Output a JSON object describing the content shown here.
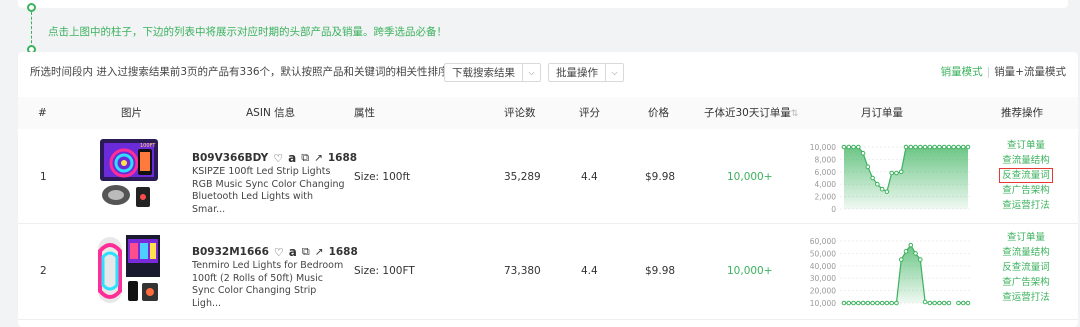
{
  "tip_text": "点击上图中的柱子，下边的列表中将展示对应时期的头部产品及销量。跨季选品必备！",
  "toolbar": {
    "info": "所选时间段内 进入过搜索结果前3页的产品有336个，默认按照产品和关键词的相关性排序",
    "download_label": "下载搜索结果",
    "batch_label": "批量操作",
    "mode_sales": "销量模式",
    "mode_sales_traffic": "销量+流量模式"
  },
  "columns": [
    "#",
    "图片",
    "ASIN 信息",
    "属性",
    "评论数",
    "评分",
    "价格",
    "子体近30天订单量",
    "月订单量",
    "推荐操作"
  ],
  "icons": [
    "heart-icon",
    "amazon-icon",
    "copy-icon",
    "external-link-icon",
    "sort-icon",
    "chevron-down-icon"
  ],
  "rows": [
    {
      "index": "1",
      "asin": "B09V366BDY",
      "badge_1688": "1688",
      "title": "KSIPZE 100ft Led Strip Lights RGB Music Sync Color Changing Bluetooth Led Lights with Smar...",
      "attribute": "Size: 100ft",
      "reviews": "35,289",
      "rating": "4.4",
      "price": "$9.98",
      "orders_30d": "10,000+",
      "chart_yticks": [
        "10,000",
        "8,000",
        "6,000",
        "4,000",
        "2,000",
        "0"
      ],
      "chart_values": [
        10000,
        10000,
        10000,
        10000,
        9000,
        6800,
        5000,
        4000,
        3200,
        2800,
        5800,
        5800,
        6000,
        10000,
        10000,
        10000,
        10000,
        10000,
        10000,
        10000,
        10000,
        10000,
        10000,
        10000,
        10000,
        10000,
        10000
      ],
      "chart_max": 10000,
      "actions": [
        "查订单量",
        "查流量结构",
        "反查流量词",
        "查广告架构",
        "查运营打法"
      ],
      "highlight_action": "反查流量词"
    },
    {
      "index": "2",
      "asin": "B0932M1666",
      "badge_1688": "1688",
      "title": "Tenmiro Led Lights for Bedroom 100ft (2 Rolls of 50ft) Music Sync Color Changing Strip Ligh...",
      "attribute": "Size: 100FT",
      "reviews": "73,380",
      "rating": "4.4",
      "price": "$9.98",
      "orders_30d": "10,000+",
      "chart_yticks": [
        "60,000",
        "50,000",
        "40,000",
        "30,000",
        "20,000",
        "10,000"
      ],
      "chart_values": [
        10000,
        10000,
        10000,
        10000,
        10000,
        10000,
        10000,
        10000,
        10000,
        10000,
        10000,
        10000,
        52000,
        60000,
        66000,
        58000,
        52000,
        11000,
        10000,
        10000,
        10000,
        10000,
        10000,
        null,
        10000,
        10000,
        10000
      ],
      "chart_max": 70000,
      "chart_min": 10000,
      "actions": [
        "查订单量",
        "查流量结构",
        "反查流量词",
        "查广告架构",
        "查运营打法"
      ],
      "highlight_action": ""
    }
  ],
  "colors": {
    "accent": "#3bb25d",
    "highlight_border": "#e53935"
  }
}
